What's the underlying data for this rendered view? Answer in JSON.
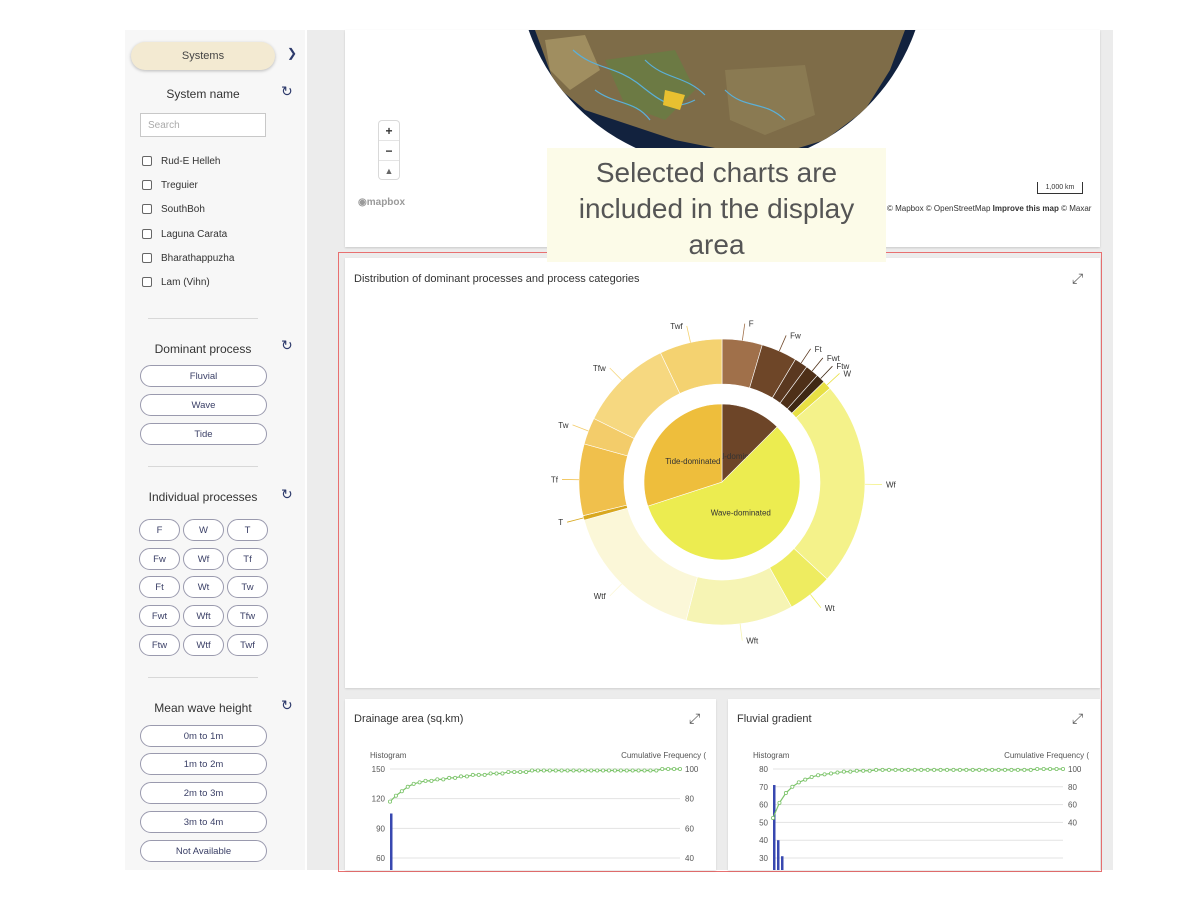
{
  "sidebar": {
    "systems_label": "Systems",
    "system_name": {
      "title": "System name",
      "search_placeholder": "Search",
      "items": [
        "Rud-E Helleh",
        "Treguier",
        "SouthBoh",
        "Laguna Carata",
        "Bharathappuzha",
        "Lam (Vihn)"
      ]
    },
    "dominant_process": {
      "title": "Dominant process",
      "options": [
        "Fluvial",
        "Wave",
        "Tide"
      ]
    },
    "individual_processes": {
      "title": "Individual processes",
      "options": [
        "F",
        "W",
        "T",
        "Fw",
        "Wf",
        "Tf",
        "Ft",
        "Wt",
        "Tw",
        "Fwt",
        "Wft",
        "Tfw",
        "Ftw",
        "Wtf",
        "Twf"
      ]
    },
    "mean_wave_height": {
      "title": "Mean wave height",
      "options": [
        "0m to 1m",
        "1m to 2m",
        "2m to 3m",
        "3m to 4m",
        "Not Available"
      ]
    }
  },
  "map": {
    "zoom_in": "+",
    "zoom_out": "−",
    "compass": "▲",
    "logo": "mapbox",
    "scale": "1,000 km",
    "attribution_prefix": "© Mapbox © OpenStreetMap",
    "improve": "Improve this map",
    "attribution_suffix": "© Maxar"
  },
  "tooltip": {
    "lines": [
      "Selected charts are",
      "included in the display",
      "area"
    ]
  },
  "colors": {
    "accent": "#2d3a6b",
    "selection_frame": "#e87070",
    "systems_button": "#f3ead2",
    "tooltip_bg": "#fcfbe8",
    "histogram_bar": "#3848b0",
    "cumulative_line": "#7cc46a"
  },
  "charts": {
    "donut_title": "Distribution of dominant processes and process categories",
    "drainage_title": "Drainage area (sq.km)",
    "gradient_title": "Fluvial gradient",
    "histogram_label": "Histogram",
    "cumulative_label": "Cumulative Frequency (",
    "expand_icon": "⤢"
  },
  "chart_data": [
    {
      "type": "pie",
      "title": "Distribution of dominant processes and process categories",
      "inner": [
        {
          "label": "Fluvial-dominated",
          "value": 12.5,
          "color": "#6d4528"
        },
        {
          "label": "Wave-dominated",
          "value": 57.5,
          "color": "#ecec50"
        },
        {
          "label": "Tide-dominated",
          "value": 30,
          "color": "#eebe3c"
        }
      ],
      "outer": [
        {
          "label": "F",
          "value": 4.5,
          "color": "#a0704a"
        },
        {
          "label": "Fw",
          "value": 4,
          "color": "#6e4628"
        },
        {
          "label": "Ft",
          "value": 1.5,
          "color": "#5a3820"
        },
        {
          "label": "Fwt",
          "value": 1.5,
          "color": "#4e3018"
        },
        {
          "label": "Ftw",
          "value": 1,
          "color": "#3e2814"
        },
        {
          "label": "W",
          "value": 1,
          "color": "#e8e044"
        },
        {
          "label": "Wf",
          "value": 23,
          "color": "#f4f28a"
        },
        {
          "label": "Wt",
          "value": 5,
          "color": "#eeec60"
        },
        {
          "label": "Wft",
          "value": 12,
          "color": "#f6f4b4"
        },
        {
          "label": "Wtf",
          "value": 16.5,
          "color": "#fbf7d8"
        },
        {
          "label": "T",
          "value": 0.5,
          "color": "#d8a820"
        },
        {
          "label": "Tf",
          "value": 8,
          "color": "#f0c04c"
        },
        {
          "label": "Tw",
          "value": 3,
          "color": "#f3cc6a"
        },
        {
          "label": "Tfw",
          "value": 10.5,
          "color": "#f6d880"
        },
        {
          "label": "Twf",
          "value": 7,
          "color": "#f4d270"
        }
      ]
    },
    {
      "type": "bar",
      "title": "Drainage area (sq.km)",
      "left_ticks": [
        150,
        120,
        90,
        60
      ],
      "right_ticks": [
        100,
        80,
        60,
        40
      ],
      "left_range": [
        60,
        150
      ],
      "histogram": [
        {
          "bin": 1,
          "count": 105
        }
      ],
      "cumulative": [
        78,
        82,
        85,
        88,
        90,
        91,
        92,
        92,
        93,
        93,
        94,
        94,
        95,
        95,
        96,
        96,
        96,
        97,
        97,
        97,
        98,
        98,
        98,
        98,
        99,
        99,
        99,
        99,
        99,
        99,
        99,
        99,
        99,
        99,
        99,
        99,
        99,
        99,
        99,
        99,
        99,
        99,
        99,
        99,
        99,
        99,
        100,
        100,
        100,
        100
      ]
    },
    {
      "type": "bar",
      "title": "Fluvial gradient",
      "left_ticks": [
        80,
        70,
        60,
        50,
        40,
        30
      ],
      "right_ticks": [
        100,
        80,
        60,
        40
      ],
      "left_range": [
        30,
        80
      ],
      "histogram": [
        {
          "bin": 1,
          "count": 71
        },
        {
          "bin": 2,
          "count": 40
        },
        {
          "bin": 3,
          "count": 31
        }
      ],
      "cumulative": [
        45,
        62,
        73,
        80,
        85,
        88,
        91,
        93,
        94,
        95,
        96,
        97,
        97,
        98,
        98,
        98,
        99,
        99,
        99,
        99,
        99,
        99,
        99,
        99,
        99,
        99,
        99,
        99,
        99,
        99,
        99,
        99,
        99,
        99,
        99,
        99,
        99,
        99,
        99,
        99,
        99,
        100,
        100,
        100,
        100,
        100
      ]
    }
  ]
}
